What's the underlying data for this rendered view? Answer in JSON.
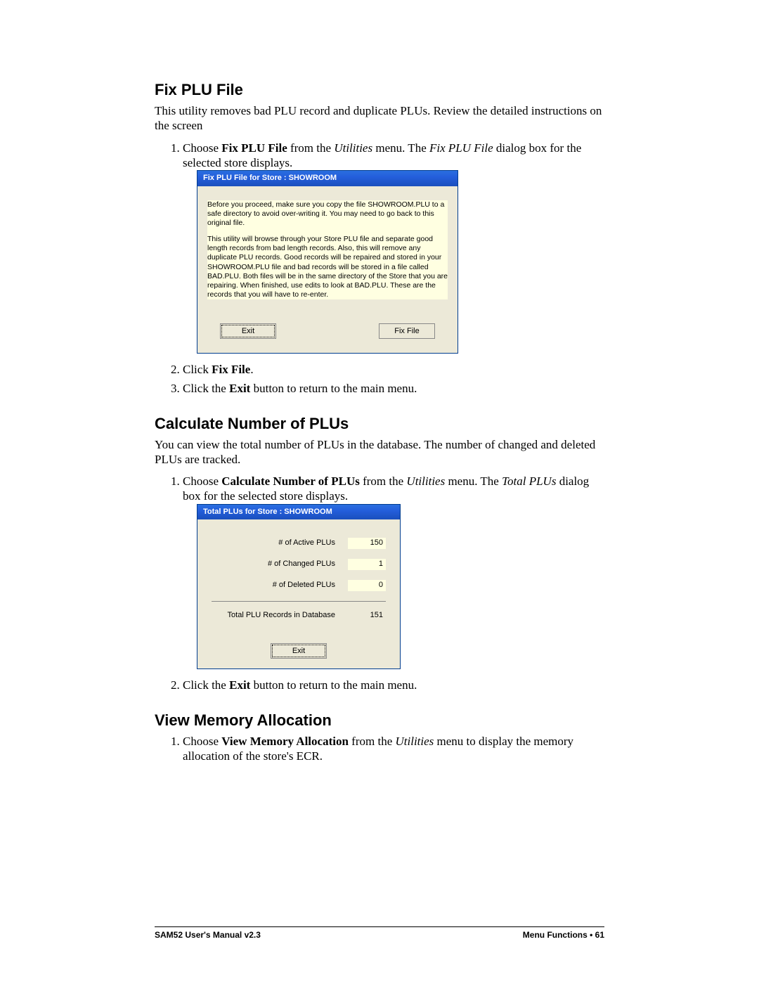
{
  "section1": {
    "heading": "Fix PLU File",
    "intro": "This utility removes bad PLU record and duplicate PLUs.  Review the detailed instructions on the screen",
    "step1_a": "Choose ",
    "step1_b": "Fix PLU File",
    "step1_c": " from the ",
    "step1_d": "Utilities",
    "step1_e": " menu.  The ",
    "step1_f": "Fix PLU File",
    "step1_g": " dialog box for the selected store displays.",
    "step2_a": "Click ",
    "step2_b": "Fix File",
    "step2_c": ".",
    "step3_a": "Click the ",
    "step3_b": "Exit",
    "step3_c": " button to return to the main menu."
  },
  "dialog1": {
    "title": "Fix PLU File for Store :  SHOWROOM",
    "para1": "Before you proceed, make sure you copy the file SHOWROOM.PLU to a safe directory to avoid over-writing it.  You may need to go back to this original file.",
    "para2": "This utility will browse through your Store PLU file and separate good length records from bad length records.  Also, this will remove any duplicate PLU records.  Good records will be repaired and stored in your SHOWROOM.PLU file and bad records will be stored in a file called BAD.PLU.  Both files will be in the same directory of the Store that you are repairing.  When finished, use edits to look at BAD.PLU.  These are the records that you will have to re-enter.",
    "btn_exit": "Exit",
    "btn_fix": "Fix File"
  },
  "section2": {
    "heading": "Calculate Number of PLUs",
    "intro": "You can view the total number of PLUs in the database.  The number of changed and deleted PLUs are tracked.",
    "step1_a": "Choose ",
    "step1_b": "Calculate Number of PLUs",
    "step1_c": " from the ",
    "step1_d": "Utilities",
    "step1_e": " menu.  The ",
    "step1_f": "Total PLUs",
    "step1_g": " dialog box for the selected store displays.",
    "step2_a": "Click the ",
    "step2_b": "Exit",
    "step2_c": " button to return to the main menu."
  },
  "dialog2": {
    "title": "Total PLUs for Store :  SHOWROOM",
    "row1_label": "# of Active PLUs",
    "row1_val": "150",
    "row2_label": "# of Changed PLUs",
    "row2_val": "1",
    "row3_label": "# of Deleted PLUs",
    "row3_val": "0",
    "row4_label": "Total PLU Records in Database",
    "row4_val": "151",
    "btn_exit": "Exit"
  },
  "section3": {
    "heading": "View Memory Allocation",
    "step1_a": "Choose ",
    "step1_b": "View Memory Allocation",
    "step1_c": " from the ",
    "step1_d": "Utilities",
    "step1_e": " menu to display the memory allocation of the store's ECR."
  },
  "footer": {
    "left": "SAM52 User's Manual v2.3",
    "right_a": "Menu Functions  ",
    "right_b": "•",
    "right_c": "  61"
  }
}
